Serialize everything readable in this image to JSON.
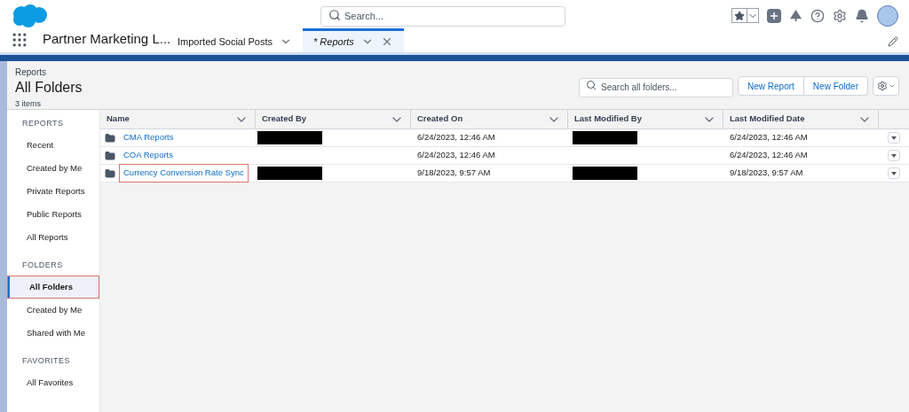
{
  "global_header": {
    "search": {
      "placeholder": "Search..."
    }
  },
  "nav": {
    "app_name": "Partner Marketing L...",
    "tabs": [
      {
        "label": "Imported Social Posts",
        "selected": false,
        "closable": false
      },
      {
        "label": "* Reports",
        "selected": true,
        "closable": true
      }
    ]
  },
  "page_header": {
    "breadcrumb": "Reports",
    "title": "All Folders",
    "count": "3 items",
    "search": {
      "placeholder": "Search all folders..."
    },
    "buttons": [
      "New Report",
      "New Folder"
    ]
  },
  "sidebar": {
    "sections": [
      {
        "heading": "REPORTS",
        "items": [
          {
            "label": "Recent",
            "selected": false,
            "highlighted": false
          },
          {
            "label": "Created by Me",
            "selected": false,
            "highlighted": false
          },
          {
            "label": "Private Reports",
            "selected": false,
            "highlighted": false
          },
          {
            "label": "Public Reports",
            "selected": false,
            "highlighted": false
          },
          {
            "label": "All Reports",
            "selected": false,
            "highlighted": false
          }
        ]
      },
      {
        "heading": "FOLDERS",
        "items": [
          {
            "label": "All Folders",
            "selected": true,
            "highlighted": true
          },
          {
            "label": "Created by Me",
            "selected": false,
            "highlighted": false
          },
          {
            "label": "Shared with Me",
            "selected": false,
            "highlighted": false
          }
        ]
      },
      {
        "heading": "FAVORITES",
        "items": [
          {
            "label": "All Favorites",
            "selected": false,
            "highlighted": false
          }
        ]
      }
    ]
  },
  "table": {
    "columns": [
      "Name",
      "Created By",
      "Created On",
      "Last Modified By",
      "Last Modified Date"
    ],
    "rows": [
      {
        "name": "CMA Reports",
        "highlighted": false,
        "created_by_redacted": true,
        "created_on": "6/24/2023, 12:46 AM",
        "last_modified_by_redacted": true,
        "last_modified_date": "6/24/2023, 12:46 AM"
      },
      {
        "name": "COA Reports",
        "highlighted": false,
        "created_by_redacted": false,
        "created_on": "6/24/2023, 12:46 AM",
        "last_modified_by_redacted": false,
        "last_modified_date": "6/24/2023, 12:46 AM"
      },
      {
        "name": "Currency Conversion Rate Sync",
        "highlighted": true,
        "created_by_redacted": true,
        "created_on": "9/18/2023, 9:57 AM",
        "last_modified_by_redacted": true,
        "last_modified_date": "9/18/2023, 9:57 AM"
      }
    ]
  }
}
